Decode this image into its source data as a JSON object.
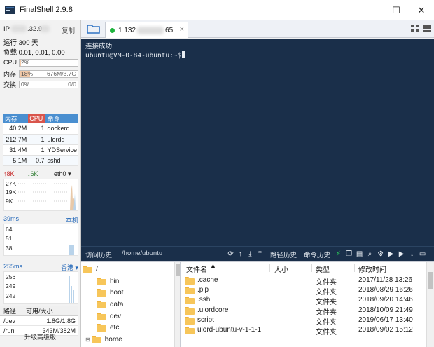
{
  "app": {
    "title": "FinalShell 2.9.8",
    "window_controls": [
      "—",
      "☐",
      "✕"
    ]
  },
  "sidebar": {
    "ip_label": "IP",
    "ip_value": ".32.9",
    "copy_label": "复制",
    "uptime": "运行 300 天",
    "load": "负载 0.01, 0.01, 0.00",
    "cpu": {
      "label": "CPU",
      "percent_text": "2%",
      "fraction": 0.02
    },
    "mem": {
      "label": "内存",
      "percent_text": "18%",
      "detail": "676M/3.7G",
      "fraction": 0.18
    },
    "swap": {
      "label": "交换",
      "percent_text": "0%",
      "detail": "0/0",
      "fraction": 0.0
    },
    "proc_headers": [
      "内存",
      "CPU",
      "命令"
    ],
    "processes": [
      {
        "mem": "40.2M",
        "cpu": "1",
        "cmd": "dockerd"
      },
      {
        "mem": "212.7M",
        "cpu": "1",
        "cmd": "ulordd"
      },
      {
        "mem": "31.4M",
        "cpu": "1",
        "cmd": "YDService"
      },
      {
        "mem": "5.1M",
        "cpu": "0.7",
        "cmd": "sshd"
      }
    ],
    "net": {
      "up": "↑8K",
      "down": "↓6K",
      "interface": "eth0 ▾",
      "ticks": [
        "27K",
        "19K",
        "9K"
      ]
    },
    "latency": {
      "value": "39ms",
      "target": "本机",
      "ticks": [
        "64",
        "51",
        "38"
      ]
    },
    "latency2": {
      "value": "255ms",
      "target": "香港 ▾",
      "ticks": [
        "256",
        "249",
        "242"
      ]
    },
    "disk_headers": [
      "路径",
      "可用/大小"
    ],
    "disks": [
      {
        "path": "/dev",
        "usage": "1.8G/1.8G"
      },
      {
        "path": "/run",
        "usage": "343M/382M"
      }
    ],
    "upgrade_label": "升级高级版"
  },
  "tabbar": {
    "tab_label_start": "1 132",
    "tab_label_end": "65",
    "close": "×"
  },
  "terminal": {
    "lines": [
      "连接成功",
      "ubuntu@VM-0-84-ubuntu:~$"
    ]
  },
  "term_toolbar": {
    "history": "访问历史",
    "path": "/home/ubuntu",
    "path_history": "路径历史",
    "cmd_history": "命令历史"
  },
  "tree": {
    "root": "/",
    "items": [
      "bin",
      "boot",
      "data",
      "dev",
      "etc",
      "home"
    ]
  },
  "filelist": {
    "headers": {
      "name": "文件名",
      "size": "大小",
      "type": "类型",
      "mtime": "修改时间"
    },
    "rows": [
      {
        "name": ".cache",
        "size": "",
        "type": "文件夹",
        "mtime": "2017/11/28 13:26"
      },
      {
        "name": ".pip",
        "size": "",
        "type": "文件夹",
        "mtime": "2018/08/29 16:26"
      },
      {
        "name": ".ssh",
        "size": "",
        "type": "文件夹",
        "mtime": "2018/09/20 14:46"
      },
      {
        "name": ".ulordcore",
        "size": "",
        "type": "文件夹",
        "mtime": "2018/10/09 21:49"
      },
      {
        "name": "script",
        "size": "",
        "type": "文件夹",
        "mtime": "2019/06/17 13:40"
      },
      {
        "name": "ulord-ubuntu-v-1-1-1",
        "size": "",
        "type": "文件夹",
        "mtime": "2018/09/02 15:12"
      }
    ]
  },
  "colors": {
    "terminal_bg": "#1a2f4a",
    "accent_blue": "#4a8fd0",
    "cpu_red": "#d9554c",
    "online_green": "#1fb33d"
  }
}
